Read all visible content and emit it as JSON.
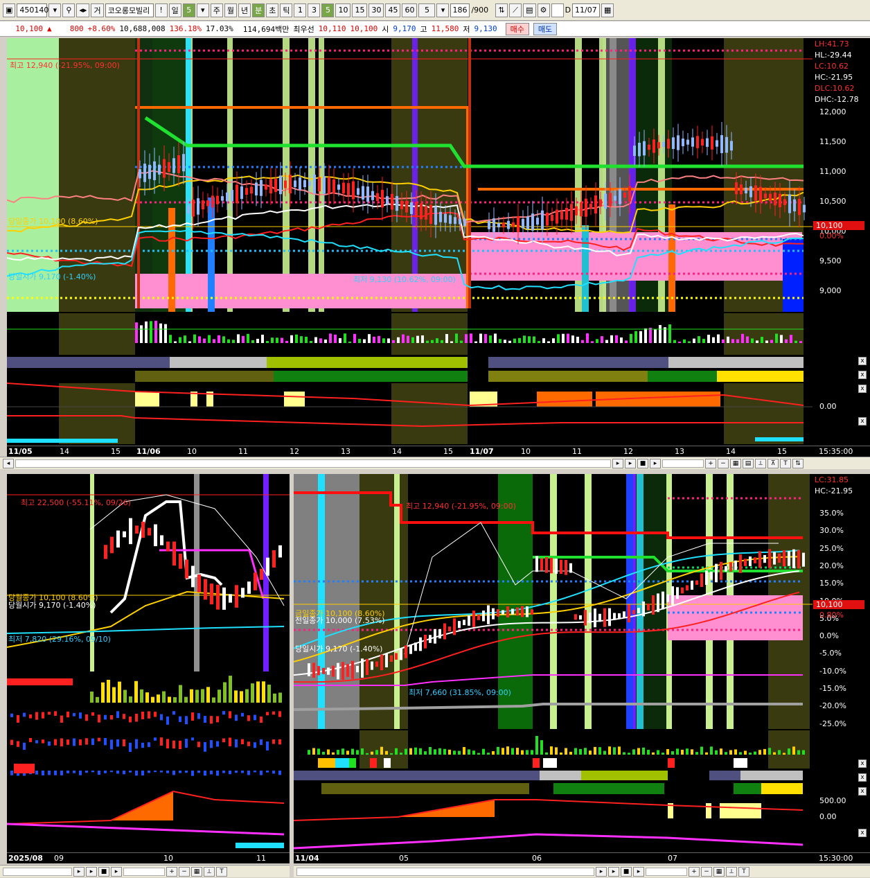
{
  "toolbar": {
    "code": "450140",
    "market_tag": "거",
    "name": "코오롱모빌리",
    "alert": "!",
    "period_day": "일",
    "day_count": "5",
    "period_week": "주",
    "period_month": "월",
    "period_year": "년",
    "period_min": "분",
    "period_sec": "초",
    "period_tick": "틱",
    "intervals": [
      "1",
      "3",
      "5",
      "10",
      "15",
      "30",
      "45",
      "60"
    ],
    "interval_sel": "5",
    "count": "186",
    "count_max": "/900",
    "date_checkbox_label": "D",
    "date_value": "11/07"
  },
  "quote": {
    "price": "10,100",
    "arrow": "▲",
    "change": "800",
    "change_pct": "+8.60%",
    "volume": "10,688,008",
    "vol_ratio": "136.18%",
    "turnover": "17.03%",
    "amount": "114,694백만",
    "best_label": "최우선",
    "ask": "10,110",
    "bid": "10,100",
    "open_label": "시",
    "open": "9,170",
    "high_label": "고",
    "high": "11,580",
    "low_label": "저",
    "low": "9,130",
    "buy_label": "매수",
    "sell_label": "매도"
  },
  "top_chart": {
    "price_labels": [
      "12,000",
      "11,500",
      "11,000",
      "10,500",
      "10,000",
      "9,500",
      "9,000"
    ],
    "current_price": "10,100",
    "current_pct": "0.00%",
    "legend": [
      "LH:41.73",
      "HL:-29.44",
      "LC:10.62",
      "HC:-21.95",
      "DLC:10.62",
      "DHC:-12.78"
    ],
    "high_note": "최고 12,940 (-21.95%, 09:00)",
    "low_note": "최저 9,130 (10.62%, 09:00)",
    "close_note": "당일종가 10,100 (8.60%)",
    "open_note": "당일시가 9,170 (-1.40%)",
    "osc_zero": "0.00",
    "dates": [
      "11/05",
      "14",
      "15",
      "11/06",
      "10",
      "11",
      "12",
      "13",
      "14",
      "15",
      "11/07",
      "10",
      "11",
      "12",
      "13",
      "14",
      "15"
    ],
    "time": "15:35:00"
  },
  "bottom_left": {
    "high_note": "최고 22,500 (-55.11%, 09/26)",
    "low_note": "최저 7,820 (29.16%, 09/10)",
    "close_note": "당월종가 10,100 (8.60%)",
    "open_note": "당월시가 9,170 (-1.40%)",
    "dates": [
      "2025/08",
      "09",
      "10",
      "11"
    ]
  },
  "bottom_right": {
    "legend": [
      "LC:31.85",
      "HC:-21.95"
    ],
    "pct_labels": [
      "35.0%",
      "30.0%",
      "25.0%",
      "20.0%",
      "15.0%",
      "10.0%",
      "5.0%",
      "0.0%",
      "-5.0%",
      "-10.0%",
      "-15.0%",
      "-20.0%",
      "-25.0%"
    ],
    "current_price": "10,100",
    "current_pct": "0.80%",
    "high_note": "최고 12,940 (-21.95%, 09:00)",
    "low_note": "최저 7,660 (31.85%, 09:00)",
    "close_note": "금일종가 10,100 (8.60%)",
    "prev_close_note": "전일종가 10,000 (7.53%)",
    "open_note": "당일시가 9,170 (-1.40%)",
    "osc_labels": [
      "500.00",
      "0.00"
    ],
    "dates": [
      "11/04",
      "05",
      "06",
      "07"
    ],
    "time": "15:30:00"
  },
  "colors": {
    "up": "#ff2020",
    "down": "#20a0ff",
    "olive": "#3a3a10",
    "green_dark": "#0e3a0e",
    "lime": "#c8f090",
    "pink": "#ff8fd0",
    "orange": "#ff6a00"
  }
}
